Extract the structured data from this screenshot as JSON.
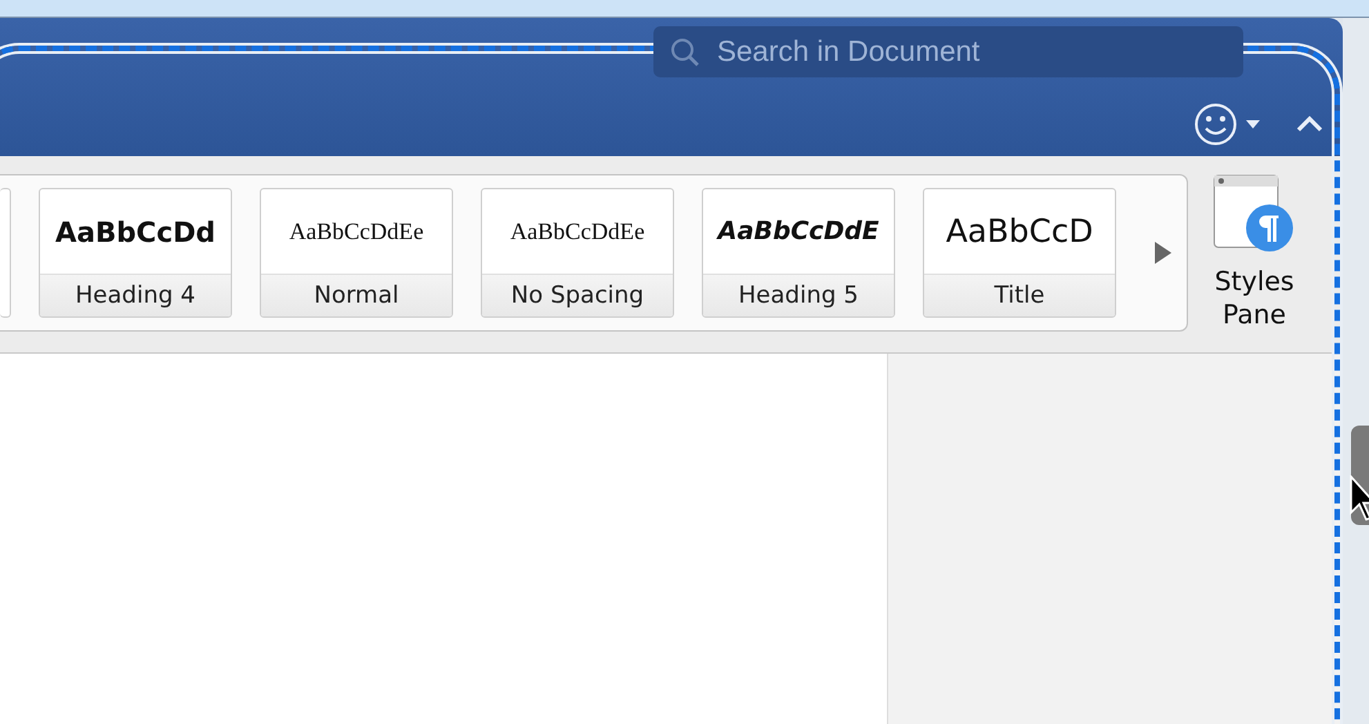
{
  "search": {
    "placeholder": "Search in Document"
  },
  "styles": [
    {
      "preview": "AaBbCcDd",
      "label": "Heading 4",
      "kind": "bold-sans"
    },
    {
      "preview": "AaBbCcDdEe",
      "label": "Normal",
      "kind": "serif"
    },
    {
      "preview": "AaBbCcDdEe",
      "label": "No Spacing",
      "kind": "serif"
    },
    {
      "preview": "AaBbCcDdE",
      "label": "Heading 5",
      "kind": "bold-italic-sans"
    },
    {
      "preview": "AaBbCcD",
      "label": "Title",
      "kind": "large-sans"
    }
  ],
  "styles_pane": {
    "label": "Styles Pane"
  }
}
